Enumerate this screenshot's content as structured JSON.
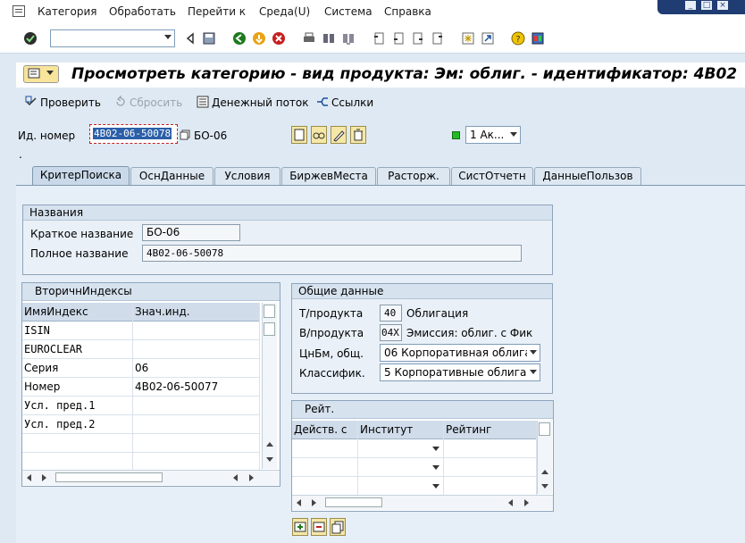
{
  "menu": [
    "Категория",
    "Обработать",
    "Перейти к",
    "Среда(U)",
    "Система",
    "Справка"
  ],
  "title": "Просмотреть категорию - вид продукта: Эм: облиг. - идентификатор: 4B02",
  "app_toolbar": {
    "check": "Проверить",
    "reset": "Сбросить",
    "cashflow": "Денежный поток",
    "links": "Ссылки"
  },
  "id_row": {
    "label": "Ид. номер",
    "value": "4B02-06-50078",
    "short": "БО-06",
    "status_combo": "1 Ак..."
  },
  "dot": ".",
  "tabs": [
    "КритерПоиска",
    "ОснДанные",
    "Условия",
    "БиржевМеста",
    "Расторж.",
    "СистОтчетн",
    "ДанныеПользов"
  ],
  "names_group": {
    "title": "Названия",
    "short_label": "Краткое название",
    "short_value": "БО-06",
    "full_label": "Полное название",
    "full_value": "4B02-06-50078"
  },
  "secondary": {
    "title": "ВторичнИндексы",
    "col1": "ИмяИндекс",
    "col2": "Знач.инд.",
    "rows": [
      [
        "ISIN",
        ""
      ],
      [
        "EUROCLEAR",
        ""
      ],
      [
        "Серия",
        "06"
      ],
      [
        "Номер",
        "4B02-06-50077"
      ],
      [
        "Усл. пред.1",
        ""
      ],
      [
        "Усл. пред.2",
        ""
      ]
    ]
  },
  "general": {
    "title": "Общие данные",
    "type_label": "Т/продукта",
    "type_code": "40",
    "type_text": "Облигация",
    "subtype_label": "В/продукта",
    "subtype_code": "04X",
    "subtype_text": "Эмиссия: облиг. с Фик",
    "cb_label": "ЦнБм, общ.",
    "cb_value": "06 Корпоративная облига...",
    "class_label": "Классифик.",
    "class_value": "5 Корпоративные облигац..."
  },
  "rating": {
    "title": "Рейт.",
    "col1": "Действ. с",
    "col2": "Институт",
    "col3": "Рейтинг"
  },
  "colors": {
    "title_bar": "#ffffff",
    "panel": "#e6eef7",
    "selection": "#2b5fa8",
    "status_led": "#22bb22",
    "window_controls": "#1f3c73"
  }
}
